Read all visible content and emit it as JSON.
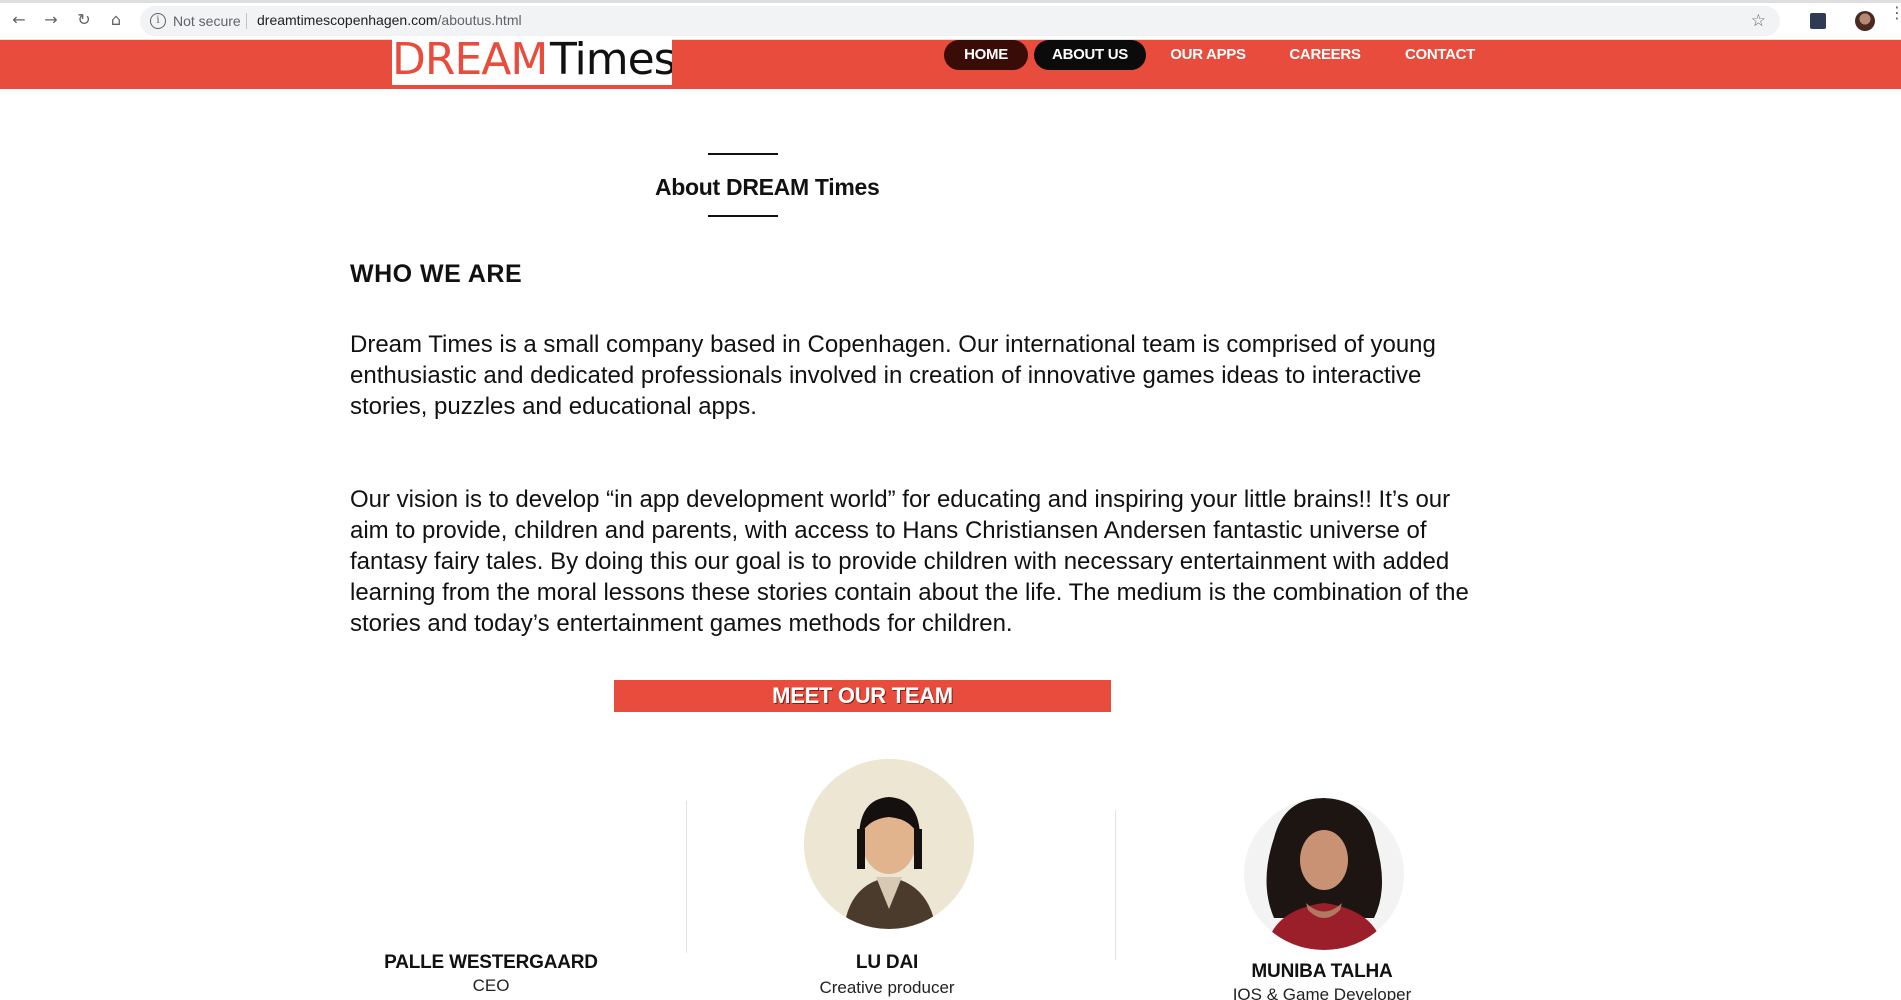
{
  "browser": {
    "security_label": "Not secure",
    "url_domain": "dreamtimescopenhagen.com",
    "url_path": "/aboutus.html"
  },
  "site": {
    "logo": {
      "part1": "DREAM",
      "part2": "Times"
    },
    "nav": [
      {
        "label": "HOME"
      },
      {
        "label": "ABOUT US"
      },
      {
        "label": "OUR APPS"
      },
      {
        "label": "CAREERS"
      },
      {
        "label": "CONTACT"
      }
    ],
    "accent_color": "#e74c3c"
  },
  "content": {
    "page_title": "About DREAM Times",
    "who_heading": "WHO WE ARE",
    "paragraph1": "Dream Times is a small company based in Copenhagen. Our international team is comprised of young enthusiastic and dedicated professionals involved in creation of innovative games ideas to interactive stories, puzzles and educational apps.",
    "paragraph2": "Our vision is to develop “in app development world” for educating and inspiring your little brains!! It’s our aim to provide, children and parents, with access to Hans Christiansen Andersen fantastic universe of fantasy fairy tales. By doing this our goal is to provide children with necessary entertainment with added learning from the moral lessons these stories contain about the life. The medium is the combination of the stories and today’s entertainment games methods for children.",
    "team_heading": "MEET OUR TEAM",
    "team": [
      {
        "name": "PALLE WESTERGAARD",
        "role": "CEO"
      },
      {
        "name": "LU DAI",
        "role": "Creative producer"
      },
      {
        "name": "MUNIBA TALHA",
        "role": "IOS & Game Developer"
      }
    ]
  }
}
